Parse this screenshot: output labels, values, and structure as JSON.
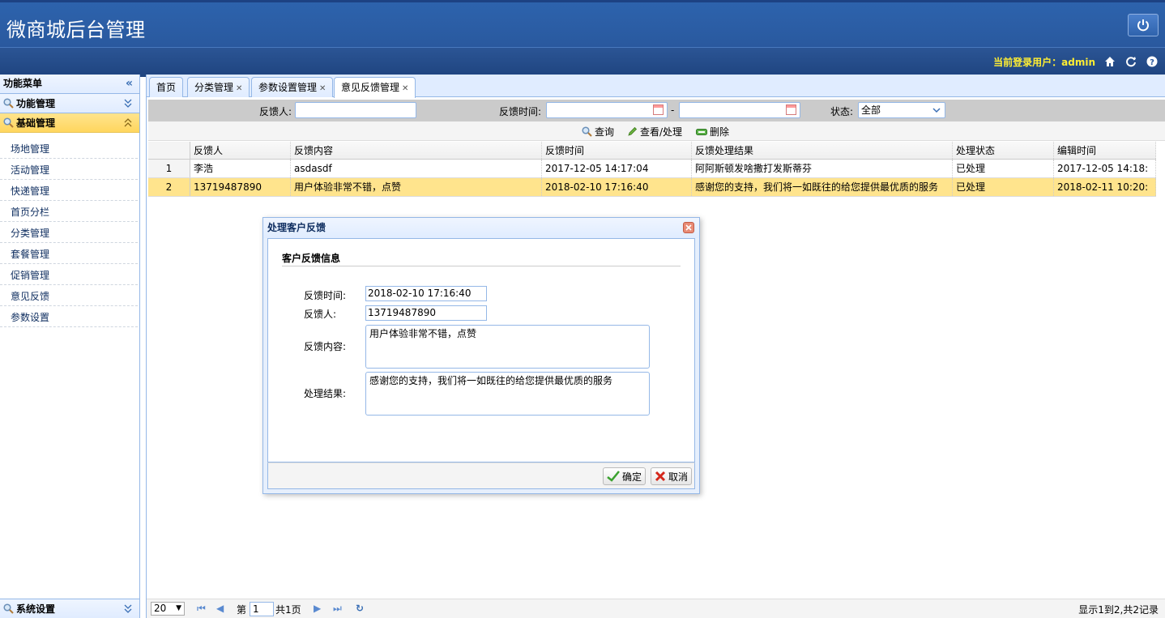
{
  "header": {
    "title": "微商城后台管理",
    "user_label": "当前登录用户：admin"
  },
  "sidebar": {
    "title": "功能菜单",
    "sections": [
      "功能管理",
      "基础管理",
      "系统设置"
    ],
    "items": [
      "场地管理",
      "活动管理",
      "快递管理",
      "首页分栏",
      "分类管理",
      "套餐管理",
      "促销管理",
      "意见反馈",
      "参数设置"
    ]
  },
  "tabs": [
    {
      "label": "首页"
    },
    {
      "label": "分类管理"
    },
    {
      "label": "参数设置管理"
    },
    {
      "label": "意见反馈管理"
    }
  ],
  "search": {
    "person_label": "反馈人:",
    "time_label": "反馈时间:",
    "dash": "-",
    "status_label": "状态:",
    "status_value": "全部"
  },
  "toolbar": {
    "query": "查询",
    "view": "查看/处理",
    "delete": "删除"
  },
  "grid": {
    "headers": [
      "反馈人",
      "反馈内容",
      "反馈时间",
      "反馈处理结果",
      "处理状态",
      "编辑时间"
    ],
    "rows": [
      {
        "n": "1",
        "person": "李浩",
        "content": "asdasdf",
        "time": "2017-12-05 14:17:04",
        "result": "阿阿斯顿发啥撒打发斯蒂芬",
        "status": "已处理",
        "edit": "2017-12-05 14:18:"
      },
      {
        "n": "2",
        "person": "13719487890",
        "content": "用户体验非常不错，点赞",
        "time": "2018-02-10 17:16:40",
        "result": "感谢您的支持，我们将一如既往的给您提供最优质的服务",
        "status": "已处理",
        "edit": "2018-02-11 10:20:"
      }
    ]
  },
  "pager": {
    "page_size": "20",
    "page_prefix": "第",
    "page_value": "1",
    "page_total": "共1页",
    "summary": "显示1到2,共2记录"
  },
  "dialog": {
    "title": "处理客户反馈",
    "section": "客户反馈信息",
    "time_label": "反馈时间:",
    "time_value": "2018-02-10 17:16:40",
    "person_label": "反馈人:",
    "person_value": "13719487890",
    "content_label": "反馈内容:",
    "content_value": "用户体验非常不错，点赞",
    "result_label": "处理结果:",
    "result_value": "感谢您的支持，我们将一如既往的给您提供最优质的服务",
    "ok": "确定",
    "cancel": "取消"
  },
  "colors": {
    "header_blue": "#2a5aa0",
    "accent_yellow": "#ffe48d",
    "user_label": "#ffee33",
    "border_blue": "#95b8e7"
  }
}
